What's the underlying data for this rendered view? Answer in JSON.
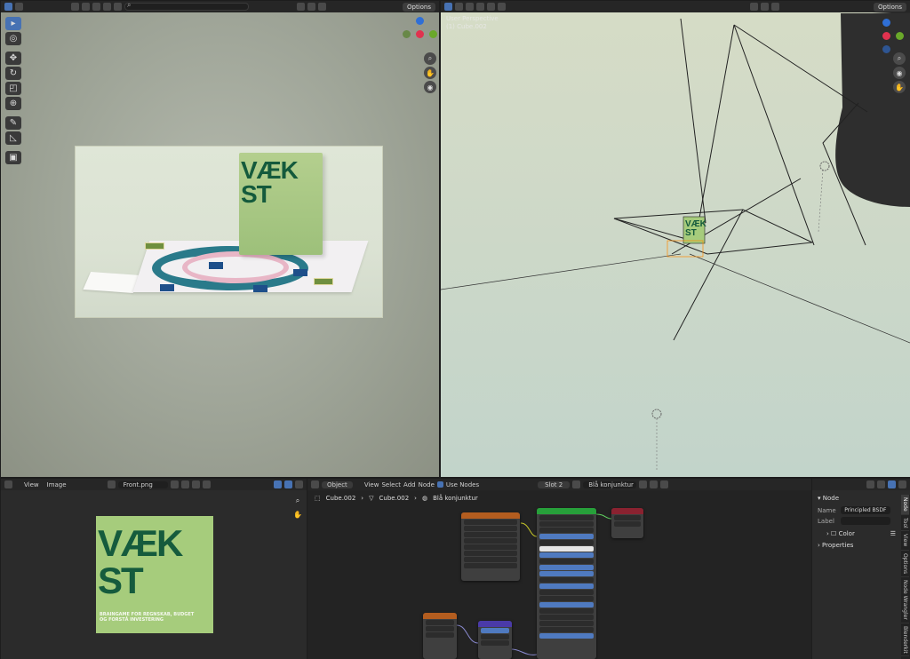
{
  "viewport_left": {
    "header": {
      "options_label": "Options"
    },
    "photo": {
      "box_title_line1": "VÆK",
      "box_title_line2": "ST"
    }
  },
  "viewport_right": {
    "header": {
      "options_label": "Options"
    },
    "overlay_line1": "User Perspective",
    "overlay_line2": "(1) Cube.002",
    "mini_box_line1": "VÆK",
    "mini_box_line2": "ST"
  },
  "image_editor": {
    "menu": [
      "View",
      "Image"
    ],
    "image_name": "Front.png",
    "cover": {
      "title_line1": "VÆK",
      "title_line2": "ST",
      "subtitle_line1": "BRAINGAME FOR REGNSKAB, BUDGET",
      "subtitle_line2": "OG FORSTÅ INVESTERING"
    }
  },
  "node_editor": {
    "mode": "Object",
    "menu": [
      "View",
      "Select",
      "Add",
      "Node"
    ],
    "use_nodes_label": "Use Nodes",
    "slot": "Slot 2",
    "material": "Blå konjunktur",
    "breadcrumb": [
      "Cube.002",
      "Cube.002",
      "Blå konjunktur"
    ]
  },
  "properties": {
    "section_node": "Node",
    "name_label": "Name",
    "name_value": "Principled BSDF",
    "label_label": "Label",
    "color_label": "Color",
    "properties_label": "Properties",
    "tabs": [
      "Node",
      "Tool",
      "View",
      "Options",
      "Node Wrangler",
      "Blenderkit"
    ]
  },
  "colors": {
    "accent": "#4772b3",
    "box_green": "#a6cc7c",
    "title_green": "#155b3d"
  }
}
